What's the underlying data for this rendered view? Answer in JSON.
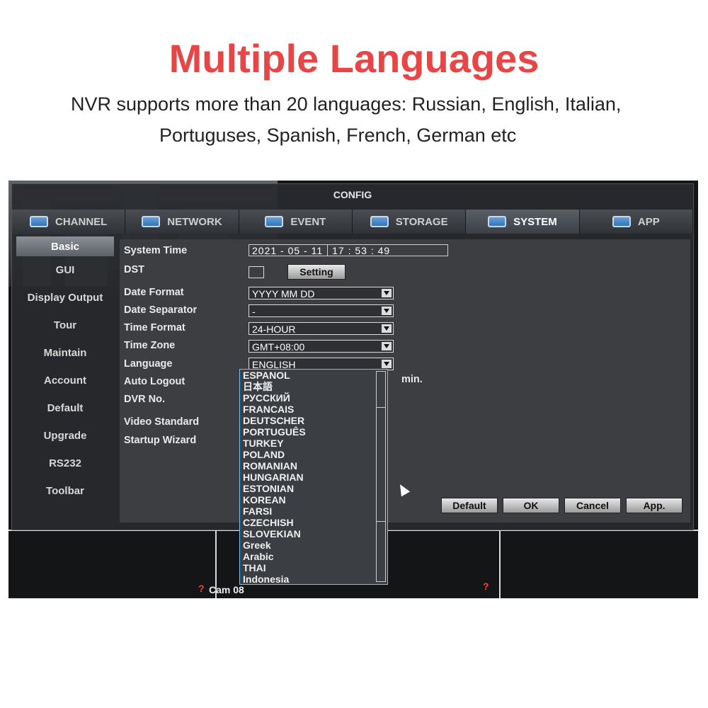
{
  "header": {
    "title": "Multiple Languages",
    "line1": "NVR supports more than 20 languages: Russian, English, Italian,",
    "line2": "Portuguses, Spanish, French, German etc"
  },
  "dialog": {
    "title": "CONFIG"
  },
  "tabs": [
    {
      "label": "CHANNEL",
      "icon": "camera-icon"
    },
    {
      "label": "NETWORK",
      "icon": "network-icon"
    },
    {
      "label": "EVENT",
      "icon": "event-icon"
    },
    {
      "label": "STORAGE",
      "icon": "storage-icon"
    },
    {
      "label": "SYSTEM",
      "icon": "system-icon"
    },
    {
      "label": "APP",
      "icon": "app-icon"
    }
  ],
  "sidebar": {
    "items": [
      "Basic",
      "GUI",
      "Display Output",
      "Tour",
      "Maintain",
      "Account",
      "Default",
      "Upgrade",
      "RS232",
      "Toolbar"
    ]
  },
  "form": {
    "system_time_label": "System Time",
    "date_part": "2021  -  05  -  11",
    "time_part": "17  :  53  :  49",
    "dst_label": "DST",
    "setting_button": "Setting",
    "date_format_label": "Date Format",
    "date_format_value": "YYYY MM DD",
    "date_separator_label": "Date Separator",
    "date_separator_value": "-",
    "time_format_label": "Time Format",
    "time_format_value": "24-HOUR",
    "time_zone_label": "Time Zone",
    "time_zone_value": "GMT+08:00",
    "language_label": "Language",
    "language_value": "ENGLISH",
    "auto_logout_label": "Auto Logout",
    "auto_logout_unit": "min.",
    "dvr_no_label": "DVR No.",
    "video_standard_label": "Video Standard",
    "startup_wizard_label": "Startup Wizard"
  },
  "language_options": [
    "ESPANOL",
    "日本語",
    "РУССКИЙ",
    "FRANCAIS",
    "DEUTSCHER",
    "PORTUGUÊS",
    "TURKEY",
    "POLAND",
    "ROMANIAN",
    "HUNGARIAN",
    "ESTONIAN",
    "KOREAN",
    "FARSI",
    "CZECHISH",
    "SLOVEKIAN",
    "Greek",
    "Arabic",
    "THAI",
    "Indonesia"
  ],
  "footer_buttons": {
    "default": "Default",
    "ok": "OK",
    "cancel": "Cancel",
    "apply": "App."
  },
  "camera": {
    "label": "Cam 08",
    "help": "?"
  }
}
